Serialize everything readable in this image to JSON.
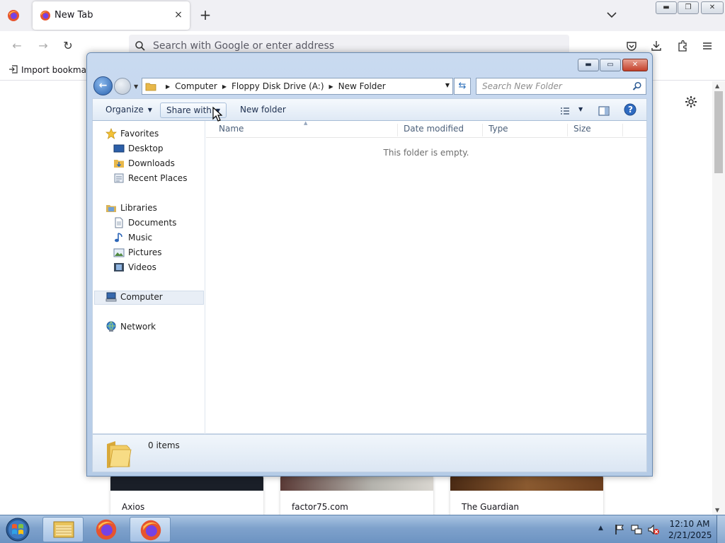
{
  "browser": {
    "tab_title": "New Tab",
    "tab_close": "×",
    "new_tab": "+",
    "url_placeholder": "Search with Google or enter address",
    "bookmark_import": "Import bookmarks...",
    "window_min": "▬",
    "window_max": "❐",
    "window_close": "✕",
    "nav_back": "←",
    "nav_forward": "→",
    "nav_reload": "↻",
    "tiles": [
      {
        "label": "Axios"
      },
      {
        "label": "factor75.com"
      },
      {
        "label": "The Guardian"
      }
    ],
    "scroll_up": "▲",
    "scroll_down": "▼"
  },
  "explorer": {
    "caption_min": "▬",
    "caption_max": "▭",
    "caption_close": "✕",
    "back_arrow": "←",
    "breadcrumbs": [
      "Computer",
      "Floppy Disk Drive (A:)",
      "New Folder"
    ],
    "crumb_sep": "▶",
    "address_dropdown": "▼",
    "refresh": "⇆",
    "search_placeholder": "Search New Folder",
    "toolbar": {
      "organize": "Organize",
      "share_with": "Share with",
      "new_folder": "New folder",
      "dropdown": "▼",
      "help": "?"
    },
    "nav": {
      "favorites": "Favorites",
      "desktop": "Desktop",
      "downloads": "Downloads",
      "recent_places": "Recent Places",
      "libraries": "Libraries",
      "documents": "Documents",
      "music": "Music",
      "pictures": "Pictures",
      "videos": "Videos",
      "computer": "Computer",
      "network": "Network"
    },
    "columns": {
      "name": "Name",
      "date_modified": "Date modified",
      "type": "Type",
      "size": "Size",
      "sort_arrow": "▲"
    },
    "empty_message": "This folder is empty.",
    "details_count": "0 items"
  },
  "taskbar": {
    "time": "12:10 AM",
    "date": "2/21/2025",
    "tray_expand": "▲"
  },
  "colors": {
    "firefox_toolbar": "#f0f0f4",
    "explorer_frame": "#b5cbe6",
    "taskbar": "#7fa2cc"
  }
}
